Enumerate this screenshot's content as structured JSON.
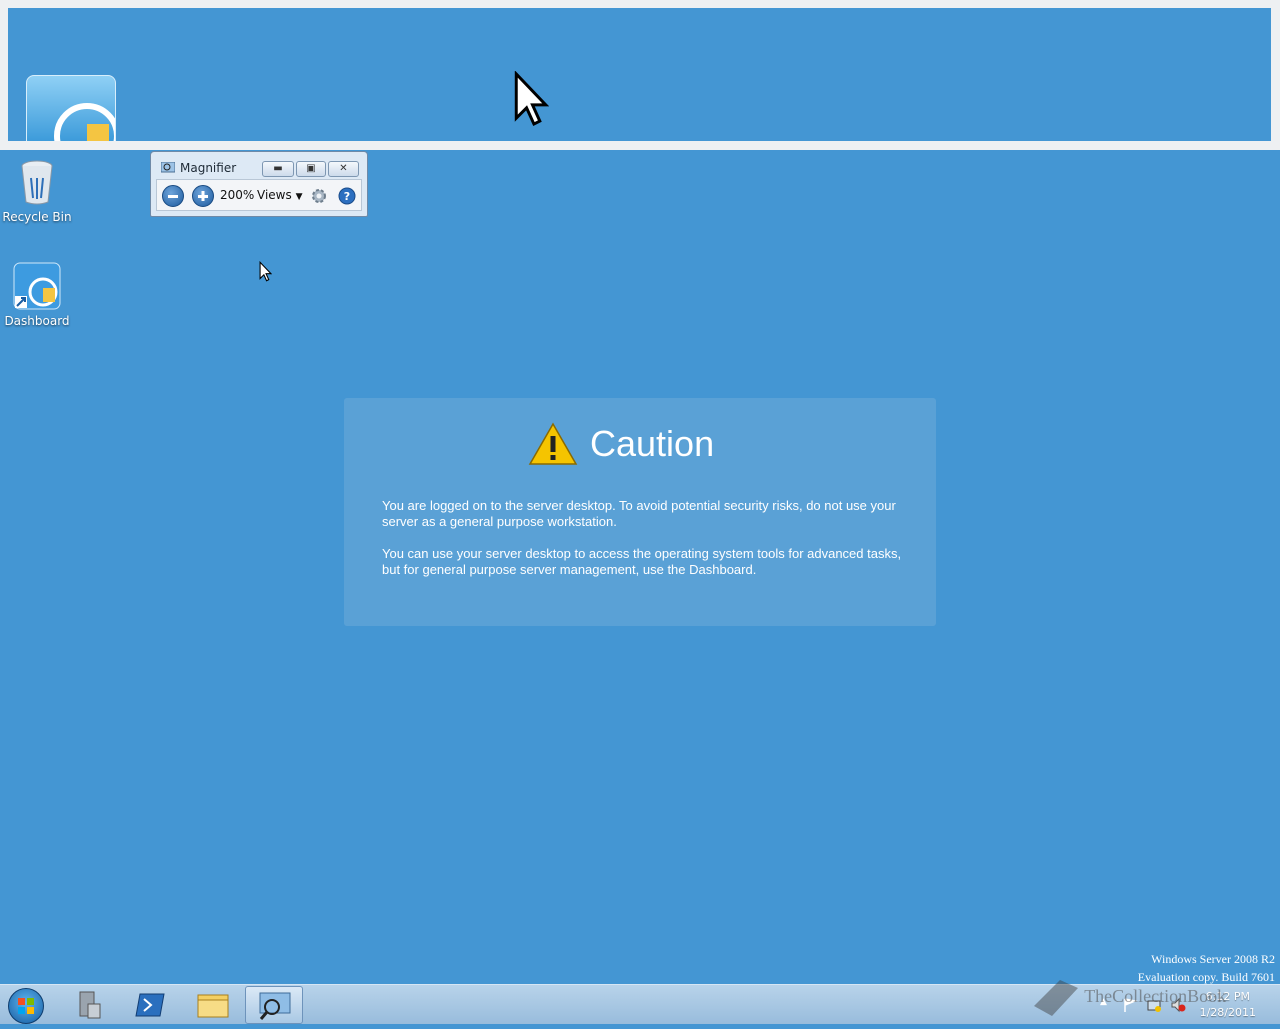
{
  "lens": {
    "magnified_cursor": "cursor-arrow-icon",
    "magnified_icon": "dashboard-icon"
  },
  "desktop": {
    "icons": [
      {
        "label": "Recycle Bin",
        "icon": "recycle-bin-icon"
      },
      {
        "label": "Dashboard",
        "icon": "dashboard-icon"
      }
    ]
  },
  "magnifier": {
    "title": "Magnifier",
    "zoom_level": "200%",
    "views_label": "Views",
    "buttons": [
      "zoom-out-icon",
      "zoom-in-icon",
      "gear-icon",
      "help-icon"
    ]
  },
  "caution": {
    "title": "Caution",
    "paragraph1": "You are logged on to the server desktop. To avoid potential security risks, do not use your server as a general purpose workstation.",
    "paragraph2": "You can use your server desktop to access the operating system tools for advanced tasks, but for general purpose server management, use the Dashboard."
  },
  "watermark": {
    "line1": "Windows Server 2008 R2",
    "line2": "Evaluation copy. Build 7601"
  },
  "overlay_watermark": "TheCollectionBook",
  "taskbar": {
    "buttons": [
      "start-orb-icon",
      "server-manager-icon",
      "powershell-icon",
      "explorer-icon",
      "magnifier-icon"
    ],
    "active": "magnifier-icon",
    "time": "6:12 PM",
    "date": "1/28/2011"
  },
  "colors": {
    "desktop": "#4496d3",
    "caution_panel": "#5aa1d6"
  }
}
